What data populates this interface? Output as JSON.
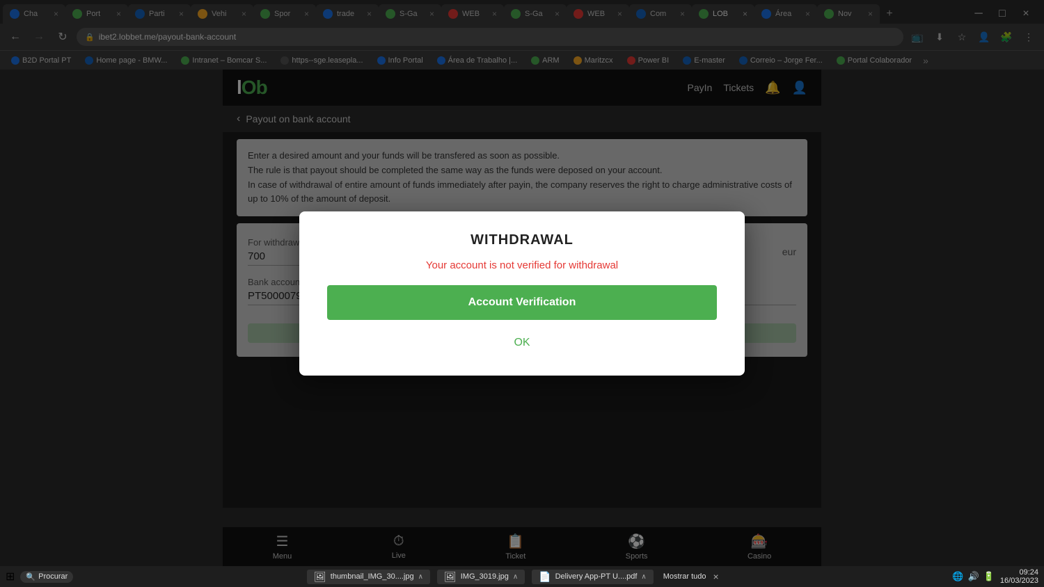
{
  "browser": {
    "tabs": [
      {
        "id": 1,
        "label": "Cha",
        "active": false,
        "favicon_color": "#1a73e8"
      },
      {
        "id": 2,
        "label": "Port",
        "active": false,
        "favicon_color": "#4caf50"
      },
      {
        "id": 3,
        "label": "Parti",
        "active": false,
        "favicon_color": "#1565c0"
      },
      {
        "id": 4,
        "label": "Vehi",
        "active": false,
        "favicon_color": "#f9a825"
      },
      {
        "id": 5,
        "label": "Spor",
        "active": false,
        "favicon_color": "#4caf50"
      },
      {
        "id": 6,
        "label": "trade",
        "active": false,
        "favicon_color": "#1a73e8"
      },
      {
        "id": 7,
        "label": "S-Ga",
        "active": false,
        "favicon_color": "#4caf50"
      },
      {
        "id": 8,
        "label": "WEB",
        "active": false,
        "favicon_color": "#e53935"
      },
      {
        "id": 9,
        "label": "S-Ga",
        "active": false,
        "favicon_color": "#4caf50"
      },
      {
        "id": 10,
        "label": "WEB",
        "active": false,
        "favicon_color": "#e53935"
      },
      {
        "id": 11,
        "label": "Com",
        "active": false,
        "favicon_color": "#1565c0"
      },
      {
        "id": 12,
        "label": "LOB",
        "active": true,
        "favicon_color": "#4caf50"
      },
      {
        "id": 13,
        "label": "Área",
        "active": false,
        "favicon_color": "#1a73e8"
      },
      {
        "id": 14,
        "label": "Nov",
        "active": false,
        "favicon_color": "#4caf50"
      }
    ],
    "address": "ibet2.lobbet.me/payout-bank-account",
    "bookmarks": [
      {
        "label": "B2D Portal PT",
        "color": "#1a73e8"
      },
      {
        "label": "Home page - BMW...",
        "color": "#1565c0"
      },
      {
        "label": "Intranet – Bomcar S...",
        "color": "#4caf50"
      },
      {
        "label": "https--sge.leasepla...",
        "color": "#555"
      },
      {
        "label": "Info Portal",
        "color": "#1a73e8"
      },
      {
        "label": "Área de Trabalho |...",
        "color": "#1a73e8"
      },
      {
        "label": "ARM",
        "color": "#4caf50"
      },
      {
        "label": "Maritzcx",
        "color": "#f9a825"
      },
      {
        "label": "Power BI",
        "color": "#e53935"
      },
      {
        "label": "E-master",
        "color": "#1565c0"
      },
      {
        "label": "Correio – Jorge Fer...",
        "color": "#1565c0"
      },
      {
        "label": "Portal Colaborador",
        "color": "#4caf50"
      }
    ]
  },
  "app": {
    "logo": "lOb",
    "header_nav": {
      "payin": "PayIn",
      "tickets": "Tickets"
    },
    "page_title": "Payout on bank account",
    "back_label": "Payout on bank account",
    "info_lines": [
      "Enter a desired amount and your funds will be transfered as soon as possible.",
      "The rule is that payout should be completed the same way as the funds were deposed on your account.",
      "In case of withdrawal of entire amount of funds immediately after payin, the company reserves the right to charge administrative costs of up to 10% of the amount of deposit."
    ],
    "form": {
      "withdrawal_label": "For withdrawal:",
      "withdrawal_value": "700",
      "currency": "eur",
      "bank_account_label": "Bank account:",
      "bank_account_value": "PT5000079000..."
    },
    "modal": {
      "title": "WITHDRAWAL",
      "warning": "Your account is not verified for withdrawal",
      "verify_btn": "Account Verification",
      "ok_btn": "OK"
    },
    "bottom_nav": [
      {
        "label": "Menu",
        "icon": "☰"
      },
      {
        "label": "Live",
        "icon": "🕐"
      },
      {
        "label": "Ticket",
        "icon": "🎫"
      },
      {
        "label": "Sports",
        "icon": "⚽"
      },
      {
        "label": "Casino",
        "icon": "🎰"
      }
    ]
  },
  "taskbar": {
    "downloads": [
      {
        "label": "thumbnail_IMG_30....jpg",
        "icon": "🖼"
      },
      {
        "label": "IMG_3019.jpg",
        "icon": "🖼"
      },
      {
        "label": "Delivery App-PT U....pdf",
        "icon": "📄"
      }
    ],
    "show_all": "Mostrar tudo",
    "time": "09:24",
    "date": "16/03/2023",
    "search_placeholder": "Procurar"
  }
}
